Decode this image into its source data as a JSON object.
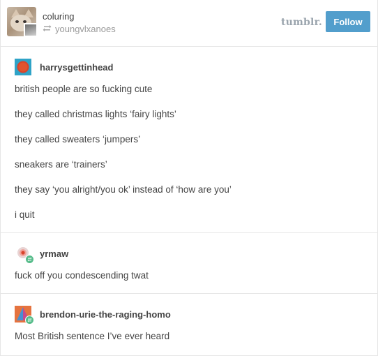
{
  "header": {
    "blog_name": "coluring",
    "reblogged_from": "youngvlxanoes",
    "logo_text": "tumblr.",
    "follow_label": "Follow"
  },
  "posts": [
    {
      "username": "harrysgettinhead",
      "avatar_icon": "red-circle-avatar-icon",
      "lines": [
        "british people are so fucking cute",
        "they called christmas lights ‘fairy lights’",
        "they called sweaters ‘jumpers’",
        "sneakers are ‘trainers’",
        "they say ‘you alright/you ok’ instead of ‘how are you’",
        "i quit"
      ]
    },
    {
      "username": "yrmaw",
      "avatar_icon": "target-avatar-icon",
      "lines": [
        "fuck off you condescending twat"
      ]
    },
    {
      "username": "brendon-urie-the-raging-homo",
      "avatar_icon": "pyramid-avatar-icon",
      "lines": [
        "Most British sentence I’ve ever heard"
      ]
    }
  ],
  "colors": {
    "follow_button": "#529ecc",
    "reblog_badge": "#56bc8a",
    "text": "#444444",
    "muted": "#999999",
    "divider": "#e6e6e6"
  }
}
